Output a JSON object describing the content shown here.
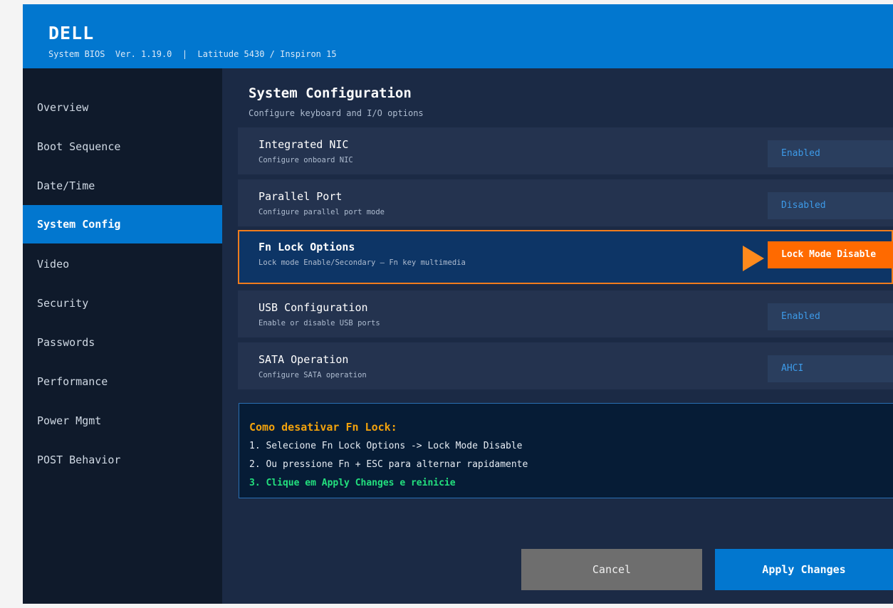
{
  "header": {
    "brand": "DELL",
    "subtitle": "System BIOS  Ver. 1.19.0  |  Latitude 5430 / Inspiron 15"
  },
  "sidebar": {
    "items": [
      {
        "label": "Overview"
      },
      {
        "label": "Boot Sequence"
      },
      {
        "label": "Date/Time"
      },
      {
        "label": "System Config",
        "active": true
      },
      {
        "label": "Video"
      },
      {
        "label": "Security"
      },
      {
        "label": "Passwords"
      },
      {
        "label": "Performance"
      },
      {
        "label": "Power Mgmt"
      },
      {
        "label": "POST Behavior"
      }
    ]
  },
  "main": {
    "title": "System Configuration",
    "subtitle": "Configure keyboard and I/O options",
    "settings": [
      {
        "title": "Integrated NIC",
        "desc": "Configure onboard NIC",
        "value": "Enabled"
      },
      {
        "title": "Parallel Port",
        "desc": "Configure parallel port mode",
        "value": "Disabled"
      },
      {
        "title": "Fn Lock Options",
        "desc": "Lock mode Enable/Secondary — Fn key multimedia",
        "value": "Lock Mode Disable",
        "selected": true
      },
      {
        "title": "USB Configuration",
        "desc": "Enable or disable USB ports",
        "value": "Enabled"
      },
      {
        "title": "SATA Operation",
        "desc": "Configure SATA operation",
        "value": "AHCI"
      }
    ],
    "help": {
      "title": "Como desativar Fn Lock:",
      "lines": [
        "1. Selecione Fn Lock Options -> Lock Mode Disable",
        "2. Ou pressione Fn + ESC para alternar rapidamente",
        "3. Clique em Apply Changes e reinicie"
      ]
    },
    "buttons": {
      "cancel": "Cancel",
      "apply": "Apply Changes"
    }
  },
  "colors": {
    "accent": "#0277cf",
    "highlight": "#ff6a00",
    "help_title": "#f2a20c",
    "help_success": "#23e07e"
  }
}
